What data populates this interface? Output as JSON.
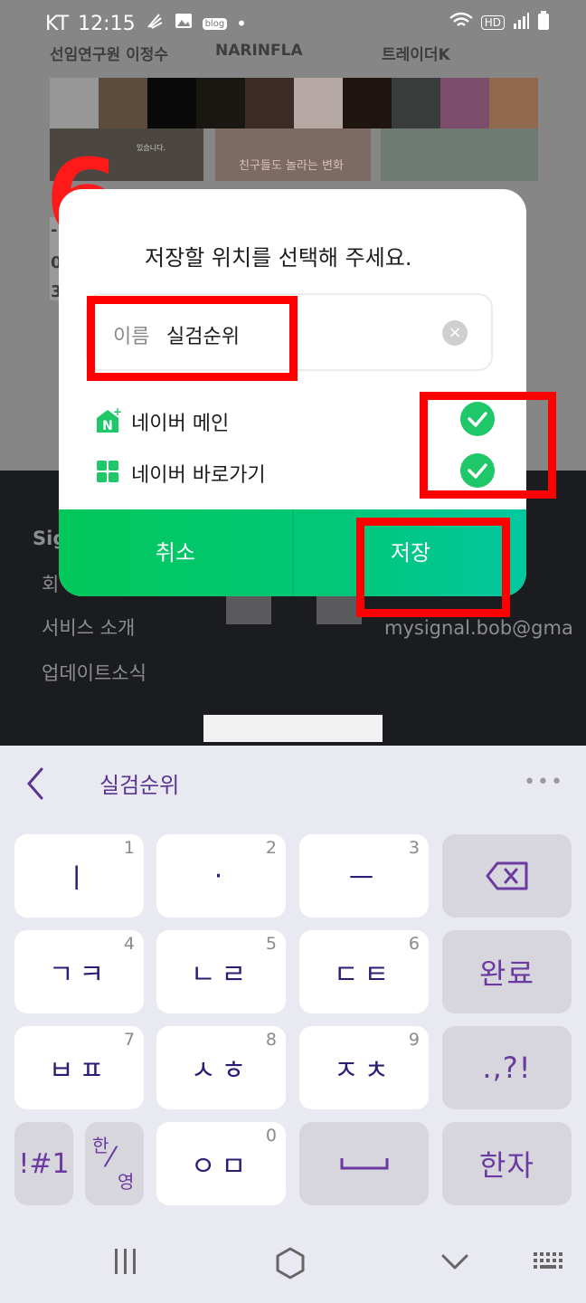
{
  "status_bar": {
    "carrier": "KT",
    "time": "12:15",
    "blog_badge": "blog",
    "hd_badge": "HD"
  },
  "feed": {
    "names": [
      "선임연구원 이정수",
      "NARINFLA",
      "트레이더K"
    ],
    "thumb_caption": "친구들도 놀라는 변화",
    "thumb_fine_caption": "있습니다."
  },
  "step_number": "6",
  "dialog": {
    "title": "저장할 위치를 선택해 주세요.",
    "name_label": "이름",
    "name_value": "실검순위",
    "options": [
      {
        "icon": "naver-main-icon",
        "label": "네이버 메인",
        "checked": true
      },
      {
        "icon": "naver-shortcut-icon",
        "label": "네이버 바로가기",
        "checked": true
      }
    ],
    "cancel_label": "취소",
    "save_label": "저장"
  },
  "background_page": {
    "left_stub_lines": [
      "-",
      "0",
      "3"
    ],
    "section_heading_fragment": "Sig",
    "links": [
      "회",
      "서비스 소개",
      "업데이트소식"
    ],
    "email_fragment": "mysignal.bob@gma"
  },
  "keyboard": {
    "candidate_word": "실검순위",
    "rows": [
      [
        {
          "label": "ㅣ",
          "num": "1"
        },
        {
          "label": "·",
          "num": "2"
        },
        {
          "label": "ㅡ",
          "num": "3"
        },
        {
          "label": "backspace",
          "icon": "backspace-icon"
        }
      ],
      [
        {
          "label": "ㄱㅋ",
          "num": "4"
        },
        {
          "label": "ㄴㄹ",
          "num": "5"
        },
        {
          "label": "ㄷㅌ",
          "num": "6"
        },
        {
          "label": "완료"
        }
      ],
      [
        {
          "label": "ㅂㅍ",
          "num": "7"
        },
        {
          "label": "ㅅㅎ",
          "num": "8"
        },
        {
          "label": "ㅈㅊ",
          "num": "9"
        },
        {
          "label": ".,?!"
        }
      ],
      [
        {
          "label": "!#1"
        },
        {
          "label": "한/영",
          "top": "한",
          "bottom": "영"
        },
        {
          "label": "ㅇㅁ",
          "num": "0"
        },
        {
          "label": "space",
          "icon": "space-icon"
        },
        {
          "label": "한자"
        }
      ]
    ]
  },
  "colors": {
    "accent_green": "#02c75a",
    "highlight_red": "#ff0000",
    "keyboard_text": "#2a1d73",
    "keyboard_accent": "#6a3aa0"
  }
}
